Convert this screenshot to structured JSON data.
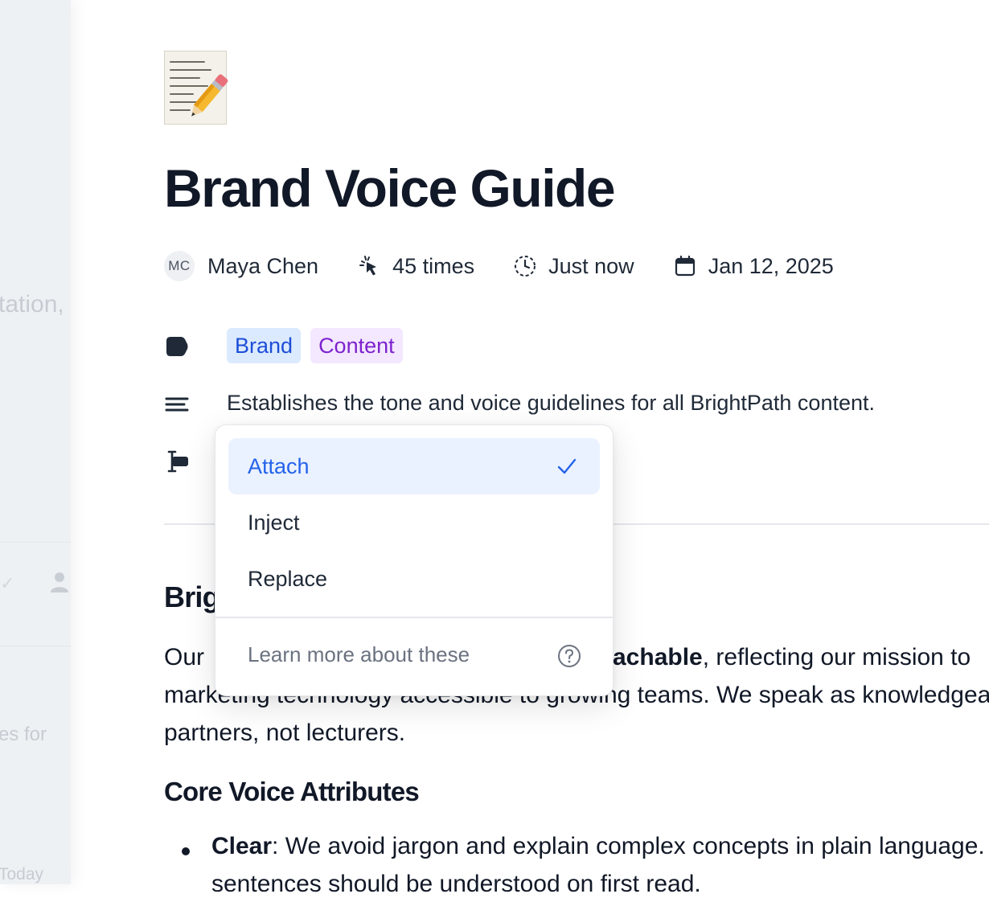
{
  "sidebar_fragments": {
    "fragment_1": "tation,",
    "fragment_2": "es for",
    "fragment_3": "Today"
  },
  "document": {
    "icon": "memo-pencil-icon",
    "title": "Brand Voice Guide",
    "meta": {
      "author_initials": "MC",
      "author": "Maya Chen",
      "uses": "45 times",
      "updated": "Just now",
      "date": "Jan 12, 2025"
    },
    "tags": [
      {
        "label": "Brand",
        "color": "#1d4ed8",
        "bg": "#dbeafe"
      },
      {
        "label": "Content",
        "color": "#7e22ce",
        "bg": "#f3e8ff"
      }
    ],
    "description": "Establishes the tone and voice guidelines for all BrightPath content.",
    "heading_partial": "Brig",
    "body_line1_start": "Our",
    "body_line1_bold": "achable",
    "body_line1_rest": ", reflecting our mission to",
    "body_line2": "marketing technology accessible to growing teams. We speak as knowledgeable",
    "body_line3": "partners, not lecturers.",
    "section_heading": "Core Voice Attributes",
    "bullet_bold": "Clear",
    "bullet_text": ": We avoid jargon and explain complex concepts in plain language.",
    "bullet_line2": "sentences should be understood on first read."
  },
  "dropdown": {
    "options": [
      "Attach",
      "Inject",
      "Replace"
    ],
    "selected": "Attach",
    "learn_more": "Learn more about these",
    "accent": "#2563eb"
  }
}
